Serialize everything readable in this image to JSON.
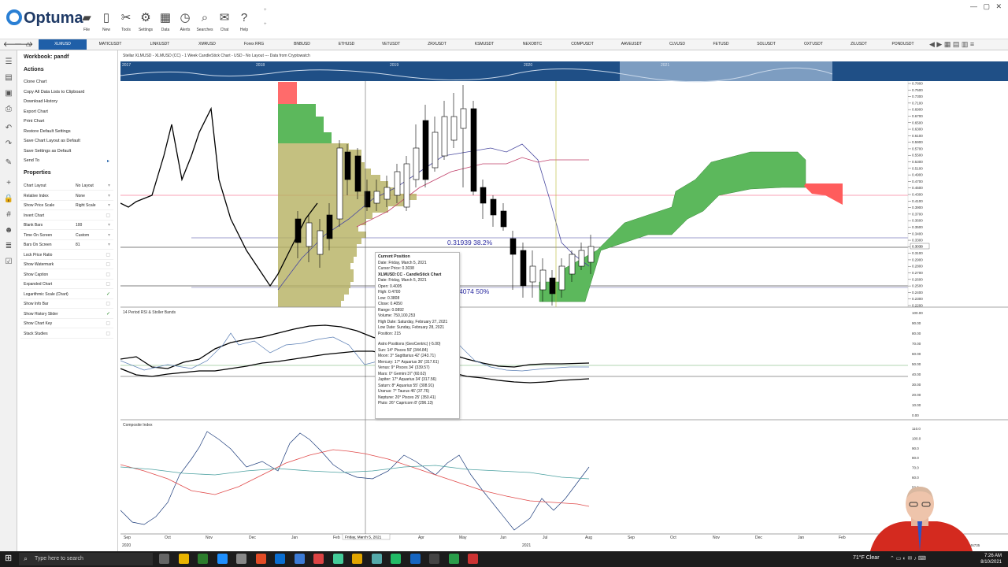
{
  "app": {
    "name": "Optuma"
  },
  "toolbar": [
    {
      "label": "File",
      "icon": "folder-icon"
    },
    {
      "label": "New",
      "icon": "new-file-icon"
    },
    {
      "label": "Tools",
      "icon": "tools-icon"
    },
    {
      "label": "Settings",
      "icon": "gear-icon"
    },
    {
      "label": "Data",
      "icon": "data-icon"
    },
    {
      "label": "Alerts",
      "icon": "alarm-icon"
    },
    {
      "label": "Searches",
      "icon": "search-icon"
    },
    {
      "label": "Chat",
      "icon": "chat-icon"
    },
    {
      "label": "Help",
      "icon": "help-icon"
    }
  ],
  "tabs": [
    "XLMUSD",
    "MATICUSDT",
    "LINKUSDT",
    "XMRUSD",
    "Forex RRG",
    "BNBUSD",
    "ETHUSD",
    "VETUSDT",
    "ZRXUSDT",
    "KSMUSDT",
    "NEXOBTC",
    "COMPUSDT",
    "AAVEUSDT",
    "CLVUSD",
    "FETUSD",
    "SOLUSDT",
    "OXTUSDT",
    "ZILUSDT",
    "PONDUSDT"
  ],
  "workbook": {
    "title": "Workbook: pandf"
  },
  "actions": {
    "title": "Actions",
    "items": [
      "Clone Chart",
      "Copy All Data Lists to Clipboard",
      "Download History",
      "Export Chart",
      "Print Chart",
      "Restore Default Settings",
      "Save Chart Layout as Default",
      "Save Settings as Default",
      "Send To"
    ]
  },
  "properties": {
    "title": "Properties",
    "items": [
      {
        "key": "Chart Layout",
        "value": "No Layout"
      },
      {
        "key": "Relative Index",
        "value": "None"
      },
      {
        "key": "Show Price Scale",
        "value": "Right Scale"
      },
      {
        "key": "Invert Chart",
        "value": ""
      },
      {
        "key": "Blank Bars",
        "value": "100"
      },
      {
        "key": "Time On Screen",
        "value": "Custom"
      },
      {
        "key": "Bars On Screen",
        "value": "81"
      },
      {
        "key": "Lock Price Ratio",
        "value": ""
      },
      {
        "key": "Show Watermark",
        "value": ""
      },
      {
        "key": "Show Caption",
        "value": ""
      },
      {
        "key": "Expanded Chart",
        "value": ""
      },
      {
        "key": "Logarithmic Scale (Chart)",
        "value": "",
        "checked": true
      },
      {
        "key": "Show Info Bar",
        "value": ""
      },
      {
        "key": "Show History Slider",
        "value": "",
        "checked": true
      },
      {
        "key": "Show Chart Key",
        "value": ""
      },
      {
        "key": "Stack Studies",
        "value": ""
      }
    ]
  },
  "chart": {
    "title": "Stellar XLMUSD - XLMUSD (CC) - 1 Week CandleStick Chart - USD - No Layout --- Data from Cryptowatch",
    "history_years": [
      "2017",
      "2018",
      "2019",
      "2020",
      "2021"
    ],
    "fib1": "0.31939   38.2%",
    "fib2": "4074   50%",
    "price_ticks": [
      "0.7800",
      "0.7500",
      "0.7300",
      "0.7100",
      "0.6900",
      "0.6700",
      "0.6500",
      "0.6300",
      "0.6100",
      "0.5900",
      "0.5700",
      "0.5500",
      "0.5300",
      "0.5100",
      "0.4900",
      "0.4700",
      "0.4500",
      "0.4300",
      "0.4100",
      "0.3900",
      "0.3700",
      "0.3600",
      "0.3500",
      "0.3400",
      "0.3300",
      "0.3200",
      "0.3100",
      "0.2900",
      "0.2800",
      "0.2700",
      "0.2600",
      "0.2500",
      "0.2400",
      "0.2300",
      "0.2200"
    ],
    "price_marker": "0.3038",
    "rsi_title": "14 Period RSI & Stoller Bands",
    "rsi_ticks": [
      "100.00",
      "90.00",
      "80.00",
      "70.00",
      "60.00",
      "50.00",
      "40.00",
      "30.00",
      "20.00",
      "10.00",
      "0.00"
    ],
    "ci_title": "Composite Index",
    "ci_ticks": [
      "110.0",
      "100.0",
      "90.0",
      "80.0",
      "70.0",
      "60.0",
      "50.0",
      "40.0",
      "30.0",
      "20.0",
      "10.0"
    ],
    "months": [
      "Sep",
      "Oct",
      "Nov",
      "Dec",
      "Jan",
      "Feb",
      "Apr",
      "May",
      "Jun",
      "Jul",
      "Aug",
      "Sep",
      "Oct",
      "Nov",
      "Dec",
      "Jan",
      "Feb"
    ],
    "cursor_date": "Friday, March 5, 2021",
    "year_2020": "2020",
    "year_2021": "2021",
    "corner_value": "0.0246735"
  },
  "tooltip": {
    "title": "Current Position",
    "lines1": [
      "Date: Friday, March 5, 2021",
      "Cursor Price: 0.3038"
    ],
    "title2": "XLMUSD:CC - CandleStick Chart",
    "lines2": [
      "Date: Friday, March 5, 2021",
      "Open: 0.4005",
      "High: 0.4700",
      "Low: 0.3808",
      "Close: 0.4050",
      "Range: 0.0892",
      "Volume: 750,100,253",
      "High Date: Saturday, February 27, 2021",
      "Low Date: Sunday, February 28, 2021",
      "Position: 215"
    ],
    "lines3": [
      "Astro Positions (GeoCentric) (-5.00)",
      "Sun: 14° Pisces 50' (344.84)",
      "Moon: 3° Sagittarius 42' (243.71)",
      "Mercury: 17° Aquarius 36' (317.61)",
      "Venus: 9° Pisces 34' (339.57)",
      "Mars: 0° Gemini 37' (60.62)",
      "Jupiter: 17° Aquarius 34' (317.56)",
      "Saturn: 8° Aquarius 55' (308.91)",
      "Uranus: 7° Taurus 46' (37.76)",
      "Neptune: 20° Pisces 25' (350.41)",
      "Pluto: 26° Capricorn 8' (296.13)"
    ]
  },
  "taskbar": {
    "search_placeholder": "Type here to search",
    "weather": "71°F  Clear",
    "time": "7:26 AM",
    "date": "8/10/2021"
  },
  "colors": {
    "accent": "#1f5fa8",
    "cloud_green": "#4caf50",
    "cloud_red": "#ff5c5c",
    "volume_profile": "#b5b060"
  }
}
